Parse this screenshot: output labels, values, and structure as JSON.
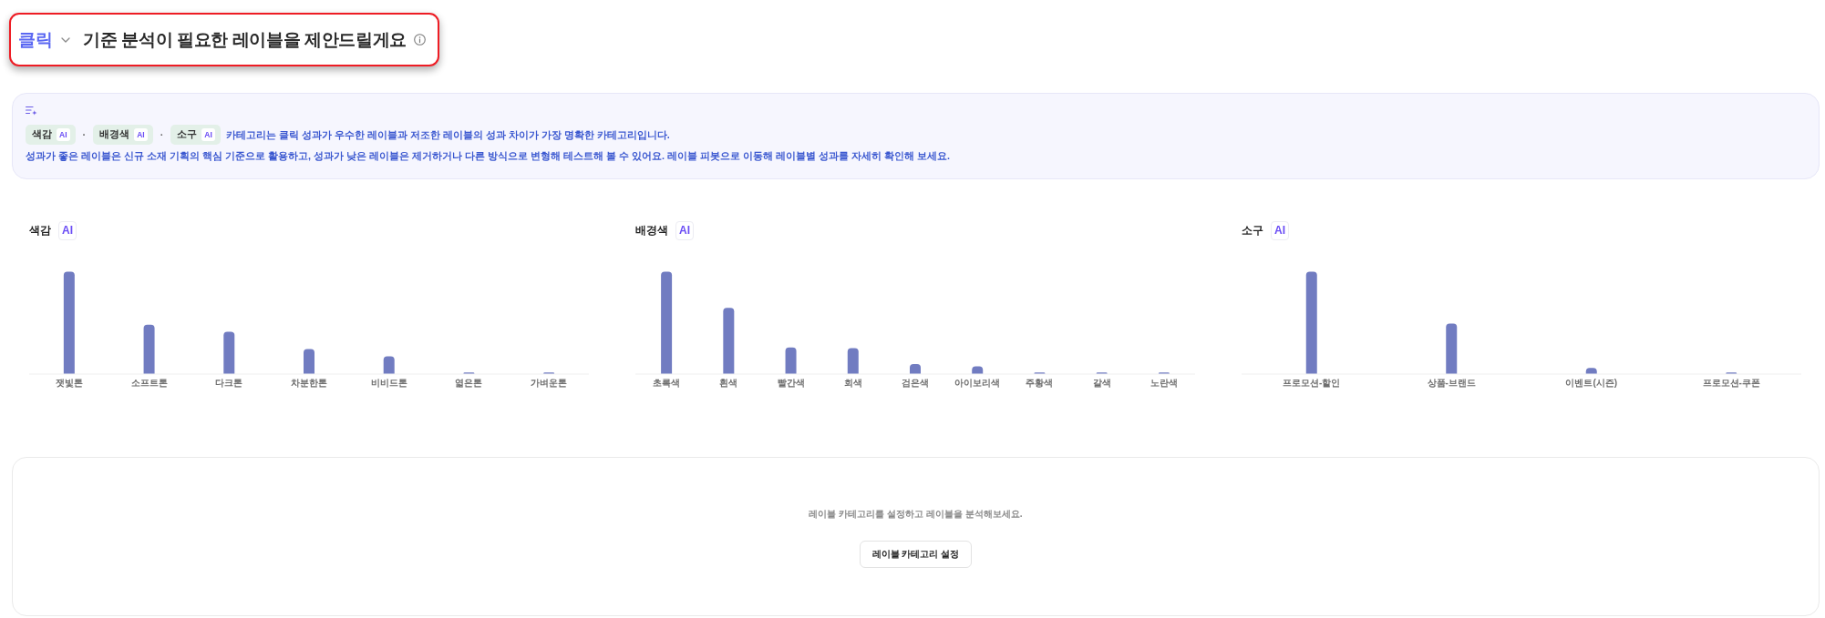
{
  "header": {
    "metric": "클릭",
    "title": "기준 분석이 필요한 레이블을 제안드릴게요"
  },
  "insight": {
    "chips": [
      {
        "label": "색감",
        "badge": "AI"
      },
      {
        "label": "배경색",
        "badge": "AI"
      },
      {
        "label": "소구",
        "badge": "AI"
      }
    ],
    "separators": [
      "·",
      "·"
    ],
    "summary": "카테고리는 클릭 성과가 우수한 레이블과 저조한 레이블의 성과 차이가 가장 명확한 카테고리입니다.",
    "detail": "성과가 좋은 레이블은 신규 소재 기획의 핵심 기준으로 활용하고, 성과가 낮은 레이블은 제거하거나 다른 방식으로 변형해 테스트해 볼 수 있어요. 레이블 피봇으로 이동해 레이블별 성과를 자세히 확인해 보세요."
  },
  "charts": [
    {
      "title": "색감",
      "badge": "AI",
      "categories": [
        "잿빛톤",
        "소프트톤",
        "다크톤",
        "차분한톤",
        "비비드톤",
        "엷은톤",
        "가벼운톤"
      ]
    },
    {
      "title": "배경색",
      "badge": "AI",
      "categories": [
        "초록색",
        "흰색",
        "빨간색",
        "회색",
        "검은색",
        "아이보리색",
        "주황색",
        "갈색",
        "노란색"
      ]
    },
    {
      "title": "소구",
      "badge": "AI",
      "categories": [
        "프로모션-할인",
        "상품-브랜드",
        "이벤트(시즌)",
        "프로모션-쿠폰"
      ]
    }
  ],
  "empty_state": {
    "message": "레이블 카테고리를 설정하고 레이블을 분석해보세요.",
    "button": "레이블 카테고리 설정"
  }
}
